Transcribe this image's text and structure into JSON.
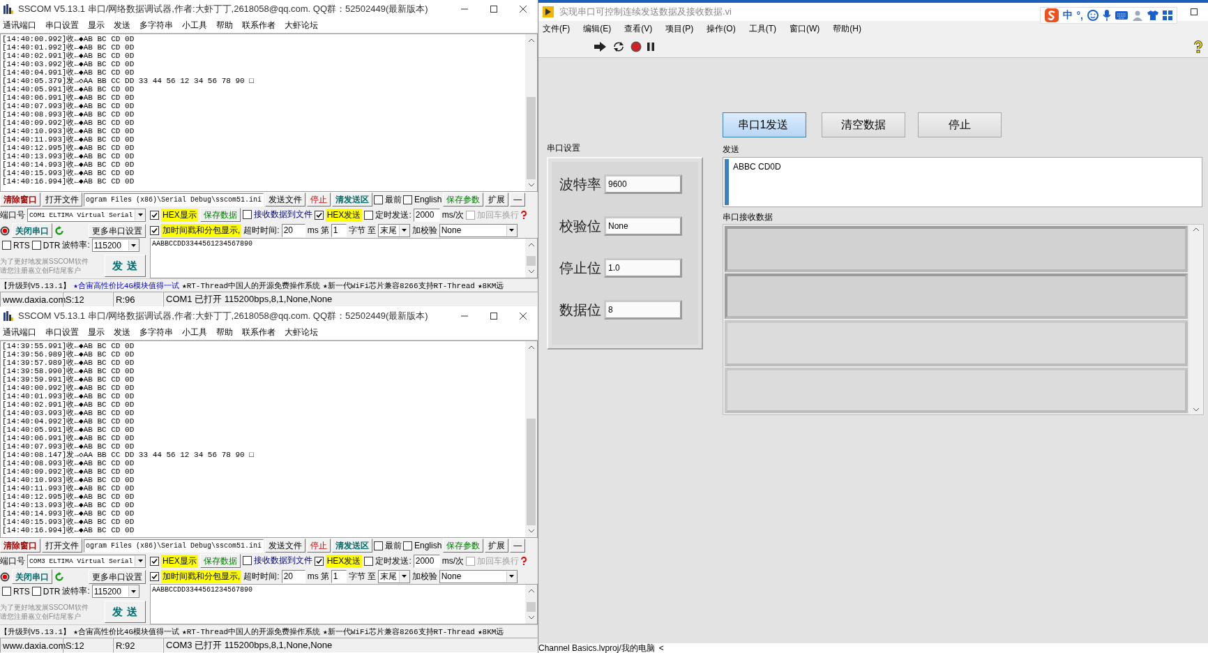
{
  "sscom_windows": [
    {
      "title": "SSCOM V5.13.1 串口/网络数据调试器,作者:大虾丁丁,2618058@qq.com. QQ群：52502449(最新版本)",
      "menu": [
        "通讯端口",
        "串口设置",
        "显示",
        "发送",
        "多字符串",
        "小工具",
        "帮助",
        "联系作者",
        "大虾论坛"
      ],
      "log": [
        "[14:40:00.992]收←◆AB BC CD 0D",
        "[14:40:01.992]收←◆AB BC CD 0D",
        "[14:40:02.991]收←◆AB BC CD 0D",
        "[14:40:03.992]收←◆AB BC CD 0D",
        "[14:40:04.991]收←◆AB BC CD 0D",
        "[14:40:05.379]发→◇AA BB CC DD 33 44 56 12 34 56 78 90 □",
        "[14:40:05.991]收←◆AB BC CD 0D",
        "[14:40:06.991]收←◆AB BC CD 0D",
        "[14:40:07.993]收←◆AB BC CD 0D",
        "[14:40:08.993]收←◆AB BC CD 0D",
        "[14:40:09.992]收←◆AB BC CD 0D",
        "[14:40:10.993]收←◆AB BC CD 0D",
        "[14:40:11.993]收←◆AB BC CD 0D",
        "[14:40:12.995]收←◆AB BC CD 0D",
        "[14:40:13.993]收←◆AB BC CD 0D",
        "[14:40:14.993]收←◆AB BC CD 0D",
        "[14:40:15.993]收←◆AB BC CD 0D",
        "[14:40:16.994]收←◆AB BC CD 0D"
      ],
      "toolbar": {
        "clear": "清除窗口",
        "open_file": "打开文件",
        "path": "ogram Files (x86)\\Serial Debug\\sscom51.ini",
        "send_file": "发送文件",
        "stop": "停止",
        "clear_send": "清发送区",
        "topmost": {
          "label": "最前",
          "checked": false
        },
        "english": {
          "label": "English",
          "checked": false
        },
        "save_params": "保存参数",
        "expand": "扩展",
        "collapse": "—"
      },
      "port": {
        "label": "端口号",
        "value": "COM1 ELTIMA Virtual Serial",
        "toggle": "关闭串口",
        "more": "更多串口设置",
        "rts": {
          "label": "RTS",
          "checked": false
        },
        "dtr": {
          "label": "DTR",
          "checked": false
        },
        "baud_label": "波特率:",
        "baud": "115200"
      },
      "receive": {
        "hex_display": {
          "label": "HEX显示",
          "checked": true
        },
        "save_data": "保存数据",
        "to_file": {
          "label": "接收数据到文件",
          "checked": false
        },
        "timestamp": {
          "label": "加时间戳和分包显示,",
          "checked": true
        },
        "timeout_label": "超时时间:",
        "timeout": "20",
        "timeout_unit": "ms",
        "from_label": "第",
        "from": "1",
        "unit": "字节",
        "to_label": "至",
        "to": "末尾"
      },
      "send": {
        "hex_send": {
          "label": "HEX发送",
          "checked": true
        },
        "timed": {
          "label": "定时发送:",
          "checked": false
        },
        "interval": "2000",
        "interval_unit": "ms/次",
        "crlf": {
          "label": "加回车换行",
          "checked": false,
          "disabled": true
        },
        "checksum_label": "加校验",
        "checksum": "None",
        "text": "AABBCCDD3344561234567890",
        "button": "发 送"
      },
      "promo": [
        "为了更好地发展SSCOM软件",
        "请您注册嘉立创F结尾客户"
      ],
      "ticker": [
        {
          "text": "【升级到V5.13.1】",
          "kind": "plain"
        },
        {
          "text": "★合宙高性价比4G模块值得一试",
          "kind": "link"
        },
        {
          "text": "★RT-Thread中国人的开源免费操作系统",
          "kind": "plain"
        },
        {
          "text": "★新一代WiFi芯片兼容8266支持RT-Thread",
          "kind": "plain"
        },
        {
          "text": "★8KM远",
          "kind": "plain"
        }
      ],
      "status": [
        "www.daxia.com",
        "S:12",
        "R:96",
        "COM1 已打开  115200bps,8,1,None,None"
      ]
    },
    {
      "title": "SSCOM V5.13.1 串口/网络数据调试器,作者:大虾丁丁,2618058@qq.com. QQ群：52502449(最新版本)",
      "menu": [
        "通讯端口",
        "串口设置",
        "显示",
        "发送",
        "多字符串",
        "小工具",
        "帮助",
        "联系作者",
        "大虾论坛"
      ],
      "log": [
        "[14:39:55.991]收←◆AB BC CD 0D",
        "[14:39:56.989]收←◆AB BC CD 0D",
        "[14:39:57.989]收←◆AB BC CD 0D",
        "[14:39:58.990]收←◆AB BC CD 0D",
        "[14:39:59.991]收←◆AB BC CD 0D",
        "[14:40:00.992]收←◆AB BC CD 0D",
        "[14:40:01.993]收←◆AB BC CD 0D",
        "[14:40:02.991]收←◆AB BC CD 0D",
        "[14:40:03.993]收←◆AB BC CD 0D",
        "[14:40:04.992]收←◆AB BC CD 0D",
        "[14:40:05.991]收←◆AB BC CD 0D",
        "[14:40:06.991]收←◆AB BC CD 0D",
        "[14:40:07.993]收←◆AB BC CD 0D",
        "[14:40:08.147]发→◇AA BB CC DD 33 44 56 12 34 56 78 90 □",
        "[14:40:08.993]收←◆AB BC CD 0D",
        "[14:40:09.992]收←◆AB BC CD 0D",
        "[14:40:10.993]收←◆AB BC CD 0D",
        "[14:40:11.993]收←◆AB BC CD 0D",
        "[14:40:12.995]收←◆AB BC CD 0D",
        "[14:40:13.993]收←◆AB BC CD 0D",
        "[14:40:14.993]收←◆AB BC CD 0D",
        "[14:40:15.993]收←◆AB BC CD 0D",
        "[14:40:16.994]收←◆AB BC CD 0D"
      ],
      "toolbar": {
        "clear": "清除窗口",
        "open_file": "打开文件",
        "path": "ogram Files (x86)\\Serial Debug\\sscom51.ini",
        "send_file": "发送文件",
        "stop": "停止",
        "clear_send": "清发送区",
        "topmost": {
          "label": "最前",
          "checked": false
        },
        "english": {
          "label": "English",
          "checked": false
        },
        "save_params": "保存参数",
        "expand": "扩展",
        "collapse": "—"
      },
      "port": {
        "label": "端口号",
        "value": "COM3 ELTIMA Virtual Serial",
        "toggle": "关闭串口",
        "more": "更多串口设置",
        "rts": {
          "label": "RTS",
          "checked": false
        },
        "dtr": {
          "label": "DTR",
          "checked": false
        },
        "baud_label": "波特率:",
        "baud": "115200"
      },
      "receive": {
        "hex_display": {
          "label": "HEX显示",
          "checked": true
        },
        "save_data": "保存数据",
        "to_file": {
          "label": "接收数据到文件",
          "checked": false
        },
        "timestamp": {
          "label": "加时间戳和分包显示,",
          "checked": true
        },
        "timeout_label": "超时时间:",
        "timeout": "20",
        "timeout_unit": "ms",
        "from_label": "第",
        "from": "1",
        "unit": "字节",
        "to_label": "至",
        "to": "末尾"
      },
      "send": {
        "hex_send": {
          "label": "HEX发送",
          "checked": true
        },
        "timed": {
          "label": "定时发送:",
          "checked": false
        },
        "interval": "2000",
        "interval_unit": "ms/次",
        "crlf": {
          "label": "加回车换行",
          "checked": false,
          "disabled": true
        },
        "checksum_label": "加校验",
        "checksum": "None",
        "text": "AABBCCDD3344561234567890",
        "button": "发 送"
      },
      "promo": [
        "为了更好地发展SSCOM软件",
        "请您注册嘉立创F结尾客户"
      ],
      "ticker": [
        {
          "text": "【升级到V5.13.1】",
          "kind": "plain"
        },
        {
          "text": "★合宙高性价比4G模块值得一试",
          "kind": "plain"
        },
        {
          "text": "★RT-Thread中国人的开源免费操作系统",
          "kind": "plain"
        },
        {
          "text": "★新一代WiFi芯片兼容8266支持RT-Thread",
          "kind": "plain"
        },
        {
          "text": "★8KM远",
          "kind": "plain"
        }
      ],
      "status": [
        "www.daxia.com",
        "S:12",
        "R:92",
        "COM3 已打开  115200bps,8,1,None,None"
      ]
    }
  ],
  "labview": {
    "title": "实现串口可控制连续发送数据及接收数据.vi",
    "ime": {
      "lang": "中",
      "punct": "°,"
    },
    "menu": [
      "文件(F)",
      "编辑(E)",
      "查看(V)",
      "项目(P)",
      "操作(O)",
      "工具(T)",
      "窗口(W)",
      "帮助(H)"
    ],
    "buttons": [
      {
        "label": "串口1发送",
        "selected": true
      },
      {
        "label": "清空数据",
        "selected": false
      },
      {
        "label": "停止",
        "selected": false
      }
    ],
    "settings": {
      "label": "串口设置",
      "fields": [
        {
          "label": "波特率",
          "value": "9600"
        },
        {
          "label": "校验位",
          "value": "None"
        },
        {
          "label": "停止位",
          "value": "1.0"
        },
        {
          "label": "数据位",
          "value": "8"
        }
      ]
    },
    "send": {
      "label": "发送",
      "value": "ABBC CD0D"
    },
    "receive": {
      "label": "串口接收数据",
      "elements": [
        {
          "disabled": false
        },
        {
          "disabled": false
        },
        {
          "disabled": true
        },
        {
          "disabled": true
        }
      ]
    },
    "status": {
      "path": "Channel Basics.lvproj/我的电脑",
      "arrow": "<"
    }
  }
}
